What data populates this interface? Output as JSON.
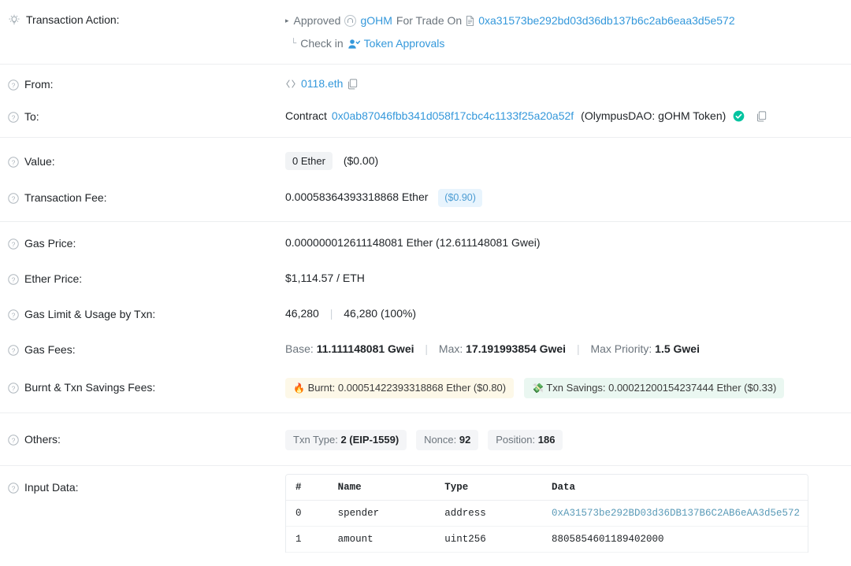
{
  "rows": {
    "transaction_action": {
      "label": "Transaction Action:",
      "icon": "lightbulb-icon",
      "caret": "▸",
      "verb": "Approved",
      "token": "gOHM",
      "middle": "For Trade On",
      "spender_address": "0xa31573be292bd03d36db137b6c2ab6eaa3d5e572",
      "tree_connector": "└",
      "check_in_text": "Check in",
      "token_approvals_link": "Token Approvals"
    },
    "from": {
      "label": "From:",
      "value": "0118.eth",
      "code_icon": "‹›",
      "copy_icon": "copy-icon"
    },
    "to": {
      "label": "To:",
      "prefix": "Contract",
      "address": "0x0ab87046fbb341d058f17cbc4c1133f25a20a52f",
      "tag": "(OlympusDAO: gOHM Token)",
      "verified_icon": "verified-check-icon",
      "copy_icon": "copy-icon"
    },
    "value": {
      "label": "Value:",
      "ether": "0 Ether",
      "usd": "($0.00)"
    },
    "transaction_fee": {
      "label": "Transaction Fee:",
      "ether": "0.00058364393318868 Ether",
      "usd": "($0.90)"
    },
    "gas_price": {
      "label": "Gas Price:",
      "value": "0.000000012611148081 Ether (12.611148081 Gwei)"
    },
    "ether_price": {
      "label": "Ether Price:",
      "value": "$1,114.57 / ETH"
    },
    "gas_limit": {
      "label": "Gas Limit & Usage by Txn:",
      "limit": "46,280",
      "separator": "|",
      "usage": "46,280 (100%)"
    },
    "gas_fees": {
      "label": "Gas Fees:",
      "base_label": "Base:",
      "base_value": "11.111148081 Gwei",
      "max_label": "Max:",
      "max_value": "17.191993854 Gwei",
      "priority_label": "Max Priority:",
      "priority_value": "1.5 Gwei",
      "separator": "|"
    },
    "burnt_savings": {
      "label": "Burnt & Txn Savings Fees:",
      "burnt_icon": "🔥",
      "burnt_text": "Burnt: 0.00051422393318868 Ether ($0.80)",
      "savings_icon": "💸",
      "savings_text": "Txn Savings: 0.00021200154237444 Ether ($0.33)"
    },
    "others": {
      "label": "Others:",
      "txn_type_label": "Txn Type:",
      "txn_type_value": "2 (EIP-1559)",
      "nonce_label": "Nonce:",
      "nonce_value": "92",
      "position_label": "Position:",
      "position_value": "186"
    },
    "input_data": {
      "label": "Input Data:",
      "columns": [
        "#",
        "Name",
        "Type",
        "Data"
      ],
      "entries": [
        {
          "index": "0",
          "name": "spender",
          "type": "address",
          "data": "0xA31573be292BD03d36DB137B6C2AB6eAA3d5e572",
          "is_link": true
        },
        {
          "index": "1",
          "name": "amount",
          "type": "uint256",
          "data": "8805854601189402000",
          "is_link": false
        }
      ]
    }
  },
  "colors": {
    "link": "#3498db",
    "verified": "#00b894",
    "burnt_badge": "#fdf8e8",
    "savings_badge": "#eaf7f1",
    "fee_badge": "#e8f4fd"
  }
}
